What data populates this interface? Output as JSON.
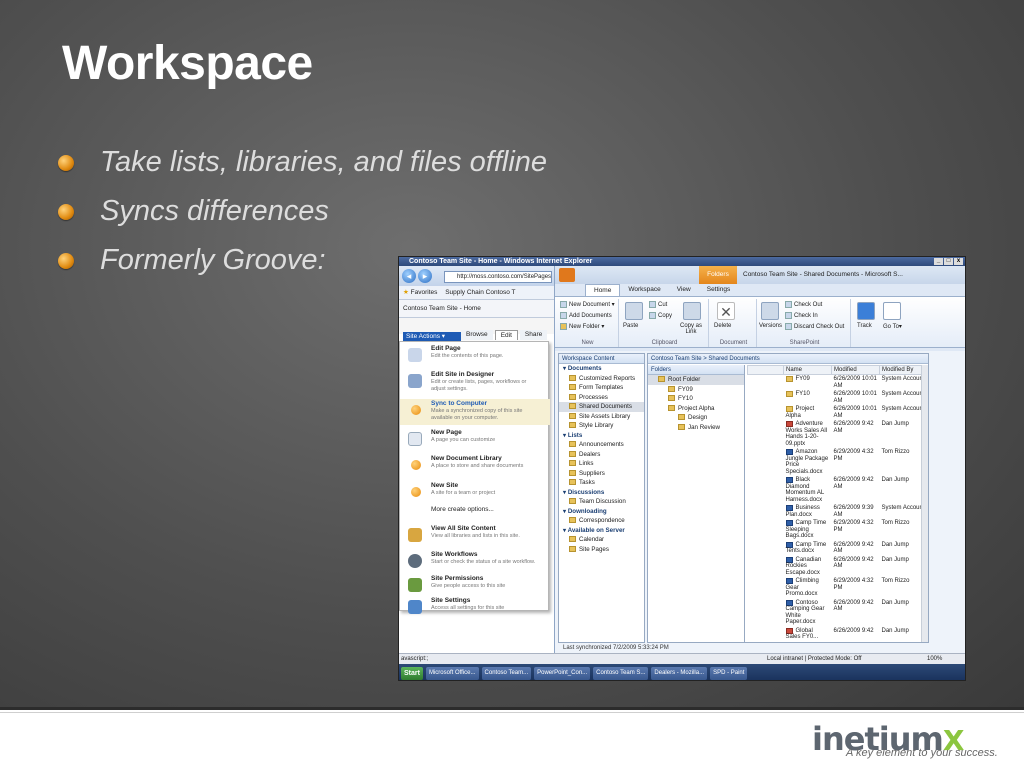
{
  "slide": {
    "title": "Workspace",
    "bullets": [
      "Take lists, libraries, and files offline",
      "Syncs differences",
      "Formerly Groove:"
    ],
    "logo_text": "inetium",
    "logo_mark": "X",
    "tagline": "A key element to your success."
  },
  "ie": {
    "title": "Contoso Team Site - Home - Windows Internet Explorer",
    "address": "http://moss.contoso.com/SitePages",
    "favorites_label": "Favorites",
    "favorites_items": "Supply Chain   Contoso T",
    "tab_label": "Contoso Team Site - Home",
    "site_actions": "Site Actions ▾",
    "sp_tabs": [
      "Browse",
      "Edit",
      "Share"
    ],
    "status_left": "avascript:;",
    "status_right": "Local intranet | Protected Mode: Off",
    "zoom": "100%"
  },
  "site_actions_menu": [
    {
      "title": "Edit Page",
      "desc": "Edit the contents of this page.",
      "icon": "edit-page-icon"
    },
    {
      "title": "Edit Site in Designer",
      "desc": "Edit or create lists, pages, workflows or adjust settings.",
      "icon": "designer-icon"
    },
    {
      "title": "Sync to Computer",
      "desc": "Make a synchronized copy of this site available on your computer.",
      "icon": "sync-icon"
    },
    {
      "title": "New Page",
      "desc": "A page you can customize",
      "icon": "new-page-icon"
    },
    {
      "title": "New Document Library",
      "desc": "A place to store and share documents",
      "icon": "doc-library-icon"
    },
    {
      "title": "New Site",
      "desc": "A site for a team or project",
      "icon": "new-site-icon"
    },
    {
      "title": "More create options...",
      "desc": "",
      "icon": ""
    },
    {
      "title": "View All Site Content",
      "desc": "View all libraries and lists in this site.",
      "icon": "site-content-icon"
    },
    {
      "title": "Site Workflows",
      "desc": "Start or check the status of a site workflow.",
      "icon": "workflow-icon"
    },
    {
      "title": "Site Permissions",
      "desc": "Give people access to this site",
      "icon": "permissions-icon"
    },
    {
      "title": "Site Settings",
      "desc": "Access all settings for this site",
      "icon": "settings-icon"
    }
  ],
  "workspace": {
    "context_tab": "Folders",
    "window_title": "Contoso Team Site - Shared Documents - Microsoft S...",
    "tabs": [
      "Home",
      "Workspace",
      "View",
      "Settings"
    ],
    "ribbon": {
      "new_document": "New Document ▾",
      "add_documents": "Add Documents",
      "new_folder": "New Folder ▾",
      "group_new": "New",
      "paste": "Paste",
      "cut": "Cut",
      "copy": "Copy",
      "copy_as_link": "Copy as Link",
      "group_clipboard": "Clipboard",
      "delete": "Delete",
      "group_document": "Document",
      "versions": "Versions",
      "check_out": "Check Out",
      "check_in": "Check In",
      "discard_check_out": "Discard Check Out",
      "track": "Track",
      "go_to": "Go To▾",
      "group_sharepoint": "SharePoint"
    },
    "content_header": "Workspace Content",
    "path": "Contoso Team Site > Shared Documents",
    "content_tree": [
      {
        "type": "sec",
        "label": "Documents"
      },
      {
        "type": "it",
        "label": "Customized Reports"
      },
      {
        "type": "it",
        "label": "Form Templates"
      },
      {
        "type": "it",
        "label": "Processes"
      },
      {
        "type": "it",
        "label": "Shared Documents"
      },
      {
        "type": "it",
        "label": "Site Assets Library"
      },
      {
        "type": "it",
        "label": "Style Library"
      },
      {
        "type": "sec",
        "label": "Lists"
      },
      {
        "type": "it",
        "label": "Announcements"
      },
      {
        "type": "it",
        "label": "Dealers"
      },
      {
        "type": "it",
        "label": "Links"
      },
      {
        "type": "it",
        "label": "Suppliers"
      },
      {
        "type": "it",
        "label": "Tasks"
      },
      {
        "type": "sec",
        "label": "Discussions"
      },
      {
        "type": "it",
        "label": "Team Discussion"
      },
      {
        "type": "sec",
        "label": "Downloading"
      },
      {
        "type": "it",
        "label": "Correspondence"
      },
      {
        "type": "sec",
        "label": "Available on Server"
      },
      {
        "type": "it",
        "label": "Calendar"
      },
      {
        "type": "it",
        "label": "Site Pages"
      }
    ],
    "folders_header": "Folders",
    "folder_tree": [
      "Root Folder",
      "FY09",
      "FY10",
      "Project Alpha",
      "Design",
      "Jan Review"
    ],
    "columns": [
      "Name",
      "Modified",
      "Modified By"
    ],
    "files": [
      {
        "name": "FY09",
        "modified": "6/26/2009 10:01 AM",
        "by": "System Account",
        "kind": "fold"
      },
      {
        "name": "FY10",
        "modified": "6/26/2009 10:01 AM",
        "by": "System Account",
        "kind": "fold"
      },
      {
        "name": "Project Alpha",
        "modified": "6/26/2009 10:01 AM",
        "by": "System Account",
        "kind": "fold"
      },
      {
        "name": "Adventure Works Sales All Hands 1-20-09.pptx",
        "modified": "6/26/2009 9:42 AM",
        "by": "Dan Jump",
        "kind": "ppt"
      },
      {
        "name": "Amazon Jungle Package Price Specials.docx",
        "modified": "6/29/2009 4:32 PM",
        "by": "Tom Rizzo",
        "kind": "doc"
      },
      {
        "name": "Black Diamond Momentum AL Harness.docx",
        "modified": "6/26/2009 9:42 AM",
        "by": "Dan Jump",
        "kind": "doc"
      },
      {
        "name": "Business Plan.docx",
        "modified": "6/26/2009 9:39 AM",
        "by": "System Account",
        "kind": "doc"
      },
      {
        "name": "Camp Time Sleeping Bags.docx",
        "modified": "6/29/2009 4:32 PM",
        "by": "Tom Rizzo",
        "kind": "doc"
      },
      {
        "name": "Camp Time Tents.docx",
        "modified": "6/26/2009 9:42 AM",
        "by": "Dan Jump",
        "kind": "doc"
      },
      {
        "name": "Canadian Rockies Escape.docx",
        "modified": "6/26/2009 9:42 AM",
        "by": "Dan Jump",
        "kind": "doc"
      },
      {
        "name": "Climbing Gear Promo.docx",
        "modified": "6/29/2009 4:32 PM",
        "by": "Tom Rizzo",
        "kind": "doc"
      },
      {
        "name": "Contoso Camping Gear White Paper.docx",
        "modified": "6/26/2009 9:42 AM",
        "by": "Dan Jump",
        "kind": "doc"
      },
      {
        "name": "Global Sales FY0...",
        "modified": "6/26/2009 9:42",
        "by": "Dan Jump",
        "kind": "ppt"
      }
    ],
    "last_sync": "Last synchronized 7/2/2009 5:33:24 PM"
  },
  "taskbar": [
    "Start",
    "Microsoft Office...",
    "Contoso Team...",
    "PowerPoint_Con...",
    "Contoso Team S...",
    "Dealers - Mozilla...",
    "SPD - Paint"
  ]
}
